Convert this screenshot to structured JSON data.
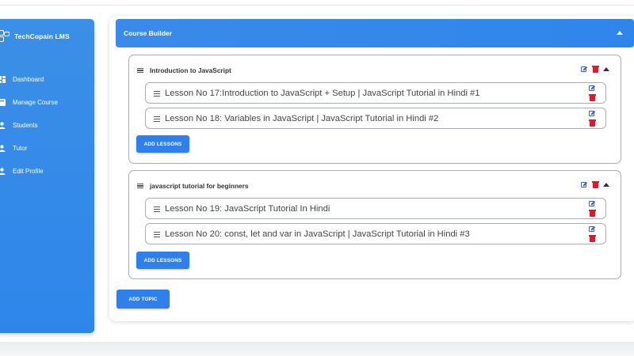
{
  "app": {
    "brand": "TechCopain LMS"
  },
  "sidebar": {
    "items": [
      {
        "label": "Dashboard",
        "icon": "dashboard-icon"
      },
      {
        "label": "Manage Course",
        "icon": "course-icon"
      },
      {
        "label": "Students",
        "icon": "user-icon"
      },
      {
        "label": "Tutor",
        "icon": "user-icon"
      },
      {
        "label": "Edit Profile",
        "icon": "user-icon"
      }
    ]
  },
  "builder": {
    "title": "Course Builder",
    "add_topic": "ADD TOPIC",
    "topics": [
      {
        "title": "Introduction to JavaScript",
        "add_lessons": "ADD LESSONS",
        "lessons": [
          "Lesson No 17:Introduction to JavaScript + Setup | JavaScript Tutorial in Hindi #1",
          "Lesson No 18: Variables in JavaScript | JavaScript Tutorial in Hindi #2"
        ]
      },
      {
        "title": "javascript tutorial for beginners",
        "add_lessons": "ADD LESSONS",
        "lessons": [
          "Lesson No 19: JavaScript Tutorial In Hindi",
          "Lesson No 20: const, let and var in JavaScript | JavaScript Tutorial in Hindi #3"
        ]
      }
    ]
  },
  "colors": {
    "primary": "#2f86ea",
    "edit": "#3b5bd6",
    "delete": "#e0182d"
  }
}
